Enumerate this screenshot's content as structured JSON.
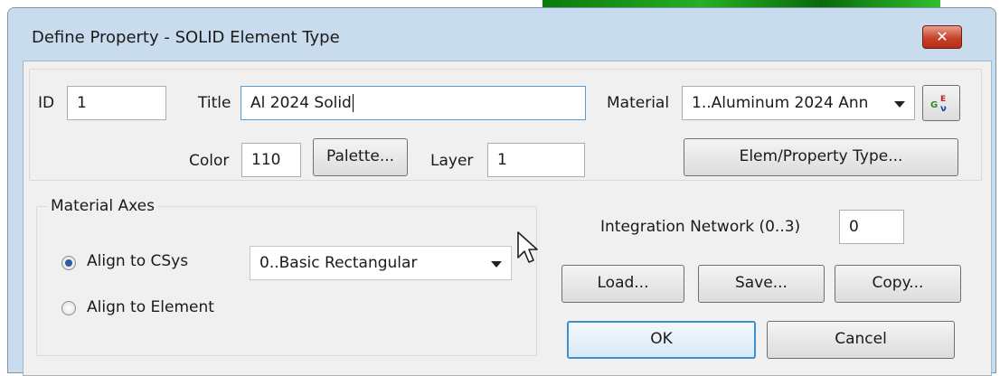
{
  "window": {
    "title": "Define Property - SOLID Element Type",
    "close_glyph": "✕"
  },
  "top": {
    "id_label": "ID",
    "id_value": "1",
    "title_label": "Title",
    "title_value": "Al 2024 Solid",
    "material_label": "Material",
    "material_value": "1..Aluminum 2024 Ann",
    "material_button_icon": "material-library-icon",
    "color_label": "Color",
    "color_value": "110",
    "palette_button": "Palette...",
    "layer_label": "Layer",
    "layer_value": "1",
    "elem_property_type_button": "Elem/Property Type..."
  },
  "material_axes": {
    "group_label": "Material Axes",
    "align_csys_label": "Align to CSys",
    "align_element_label": "Align to Element",
    "selected": "Align to CSys",
    "csys_value": "0..Basic Rectangular"
  },
  "integration": {
    "label": "Integration Network (0..3)",
    "value": "0"
  },
  "buttons": {
    "load": "Load...",
    "save": "Save...",
    "copy": "Copy...",
    "ok": "OK",
    "cancel": "Cancel"
  }
}
